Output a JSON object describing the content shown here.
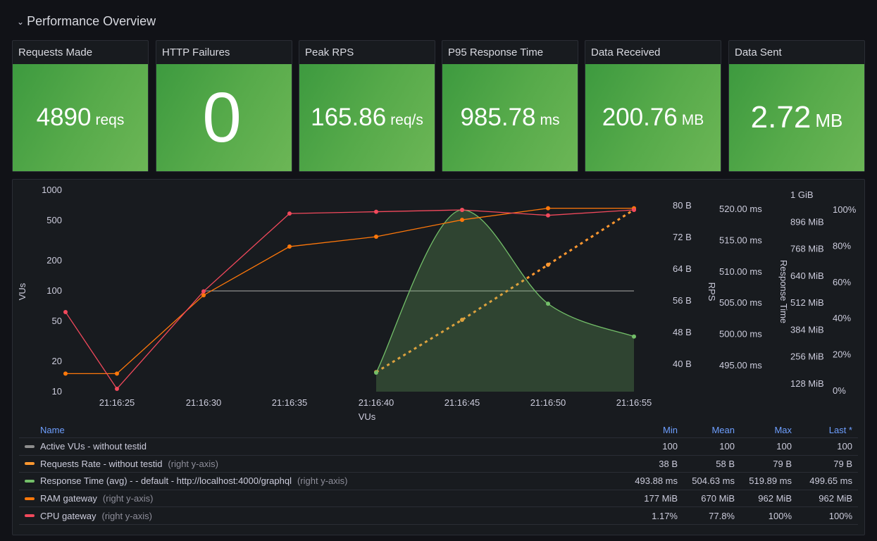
{
  "row": {
    "title": "Performance Overview",
    "icon": "chevron-down-icon"
  },
  "stats": [
    {
      "title": "Requests Made",
      "value": "4890",
      "unit": "reqs"
    },
    {
      "title": "HTTP Failures",
      "value": "0",
      "unit": ""
    },
    {
      "title": "Peak RPS",
      "value": "165.86",
      "unit": "req/s"
    },
    {
      "title": "P95 Response Time",
      "value": "985.78",
      "unit": "ms"
    },
    {
      "title": "Data Received",
      "value": "200.76",
      "unit": "MB"
    },
    {
      "title": "Data Sent",
      "value": "2.72",
      "unit": "MB"
    }
  ],
  "colors": {
    "stat_green": "#56aa4a",
    "vus": "#8e8e8e",
    "rps": "#ff9830",
    "response": "#73bf69",
    "ram": "#ff780a",
    "cpu": "#f2495c",
    "legend_header": "#6e9fff"
  },
  "chart_data": {
    "type": "line",
    "x": [
      "21:16:22",
      "21:16:25",
      "21:16:30",
      "21:16:35",
      "21:16:40",
      "21:16:45",
      "21:16:50",
      "21:16:55"
    ],
    "xticks": [
      "21:16:25",
      "21:16:30",
      "21:16:35",
      "21:16:40",
      "21:16:45",
      "21:16:50",
      "21:16:55"
    ],
    "xlabel": "VUs",
    "axes": {
      "left": {
        "label": "VUs",
        "scale": "log",
        "range": [
          10,
          1000
        ],
        "ticks": [
          "1000",
          "500",
          "200",
          "100",
          "50",
          "20",
          "10"
        ],
        "tick_values": [
          1000,
          500,
          200,
          100,
          50,
          20,
          10
        ]
      },
      "rps": {
        "label": "RPS",
        "range": [
          36,
          81
        ],
        "ticks": [
          "80 B",
          "72 B",
          "64 B",
          "56 B",
          "48 B",
          "40 B"
        ],
        "tick_values": [
          80,
          72,
          64,
          56,
          48,
          40
        ]
      },
      "response": {
        "label": "Response Time",
        "range": [
          492,
          520.7
        ],
        "ticks": [
          "520.00 ms",
          "515.00 ms",
          "510.00 ms",
          "505.00 ms",
          "500.00 ms",
          "495.00 ms"
        ],
        "tick_values": [
          520,
          515,
          510,
          505,
          500,
          495
        ]
      },
      "ram": {
        "label": "",
        "range": [
          97,
          1050
        ],
        "ticks": [
          "1 GiB",
          "896 MiB",
          "768 MiB",
          "640 MiB",
          "512 MiB",
          "384 MiB",
          "256 MiB",
          "128 MiB"
        ],
        "tick_values": [
          1024,
          896,
          768,
          640,
          512,
          384,
          256,
          128
        ]
      },
      "cpu": {
        "label": "",
        "range": [
          0,
          100
        ],
        "ticks": [
          "100%",
          "80%",
          "60%",
          "40%",
          "20%",
          "0%"
        ],
        "tick_values": [
          100,
          80,
          60,
          40,
          20,
          0
        ]
      }
    },
    "grid": false,
    "series": [
      {
        "name": "Active VUs - without testid",
        "axis": "left",
        "values": [
          null,
          null,
          100,
          100,
          100,
          100,
          100,
          100
        ],
        "style": "solid"
      },
      {
        "name": "Requests Rate - without testid",
        "axis": "rps",
        "values": [
          null,
          null,
          null,
          null,
          38,
          51.2,
          65.1,
          79
        ],
        "style": "dotted"
      },
      {
        "name": "Response Time (avg) - - default - http://localhost:4000/graphql",
        "axis": "response",
        "values": [
          null,
          null,
          null,
          null,
          493.88,
          519.89,
          504.9,
          499.65
        ],
        "style": "smooth-fill"
      },
      {
        "name": "RAM gateway",
        "axis": "ram",
        "values": [
          177,
          177,
          549,
          780,
          827,
          907,
          962,
          962
        ],
        "style": "solid"
      },
      {
        "name": "CPU gateway",
        "axis": "cpu",
        "values": [
          43.6,
          1.17,
          55,
          98,
          99,
          100,
          97,
          100
        ],
        "style": "solid"
      }
    ]
  },
  "legend": {
    "headers": {
      "name": "Name",
      "min": "Min",
      "mean": "Mean",
      "max": "Max",
      "last": "Last *"
    },
    "rows": [
      {
        "name": "Active VUs - without testid",
        "axis": "",
        "min": "100",
        "mean": "100",
        "max": "100",
        "last": "100"
      },
      {
        "name": "Requests Rate - without testid",
        "axis": "(right y-axis)",
        "min": "38 B",
        "mean": "58 B",
        "max": "79 B",
        "last": "79 B"
      },
      {
        "name": "Response Time (avg) - - default - http://localhost:4000/graphql",
        "axis": "(right y-axis)",
        "min": "493.88 ms",
        "mean": "504.63 ms",
        "max": "519.89 ms",
        "last": "499.65 ms"
      },
      {
        "name": "RAM gateway",
        "axis": "(right y-axis)",
        "min": "177 MiB",
        "mean": "670 MiB",
        "max": "962 MiB",
        "last": "962 MiB"
      },
      {
        "name": "CPU gateway",
        "axis": "(right y-axis)",
        "min": "1.17%",
        "mean": "77.8%",
        "max": "100%",
        "last": "100%"
      }
    ]
  }
}
